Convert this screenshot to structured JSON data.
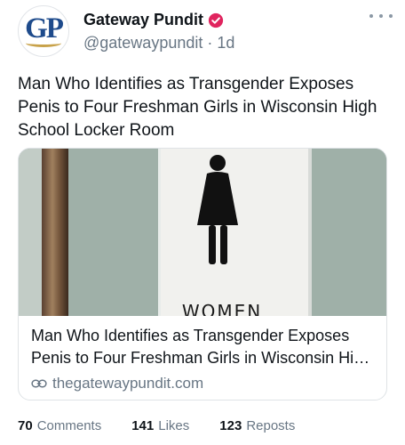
{
  "author": {
    "avatar_text": "GP",
    "display_name": "Gateway Pundit",
    "handle": "@gatewaypundit",
    "separator": "·",
    "time": "1d"
  },
  "post": {
    "text": "Man Who Identifies as Transgender Exposes Penis to Four Freshman Girls in Wisconsin High School Locker Room"
  },
  "link_card": {
    "image_sign_text": "WOMEN",
    "title": "Man Who Identifies as Transgender Exposes Penis to Four Freshman Girls in Wisconsin High School Locker Room",
    "domain": "thegatewaypundit.com"
  },
  "stats": [
    {
      "count": "70",
      "label": "Comments"
    },
    {
      "count": "141",
      "label": "Likes"
    },
    {
      "count": "123",
      "label": "Reposts"
    }
  ],
  "colors": {
    "verified": "#e0245e",
    "secondary_text": "#687684",
    "avatar_text": "#1e4b8c"
  },
  "icons": {
    "verified": "verified-badge-icon",
    "more": "more-options-icon",
    "link": "link-icon"
  }
}
